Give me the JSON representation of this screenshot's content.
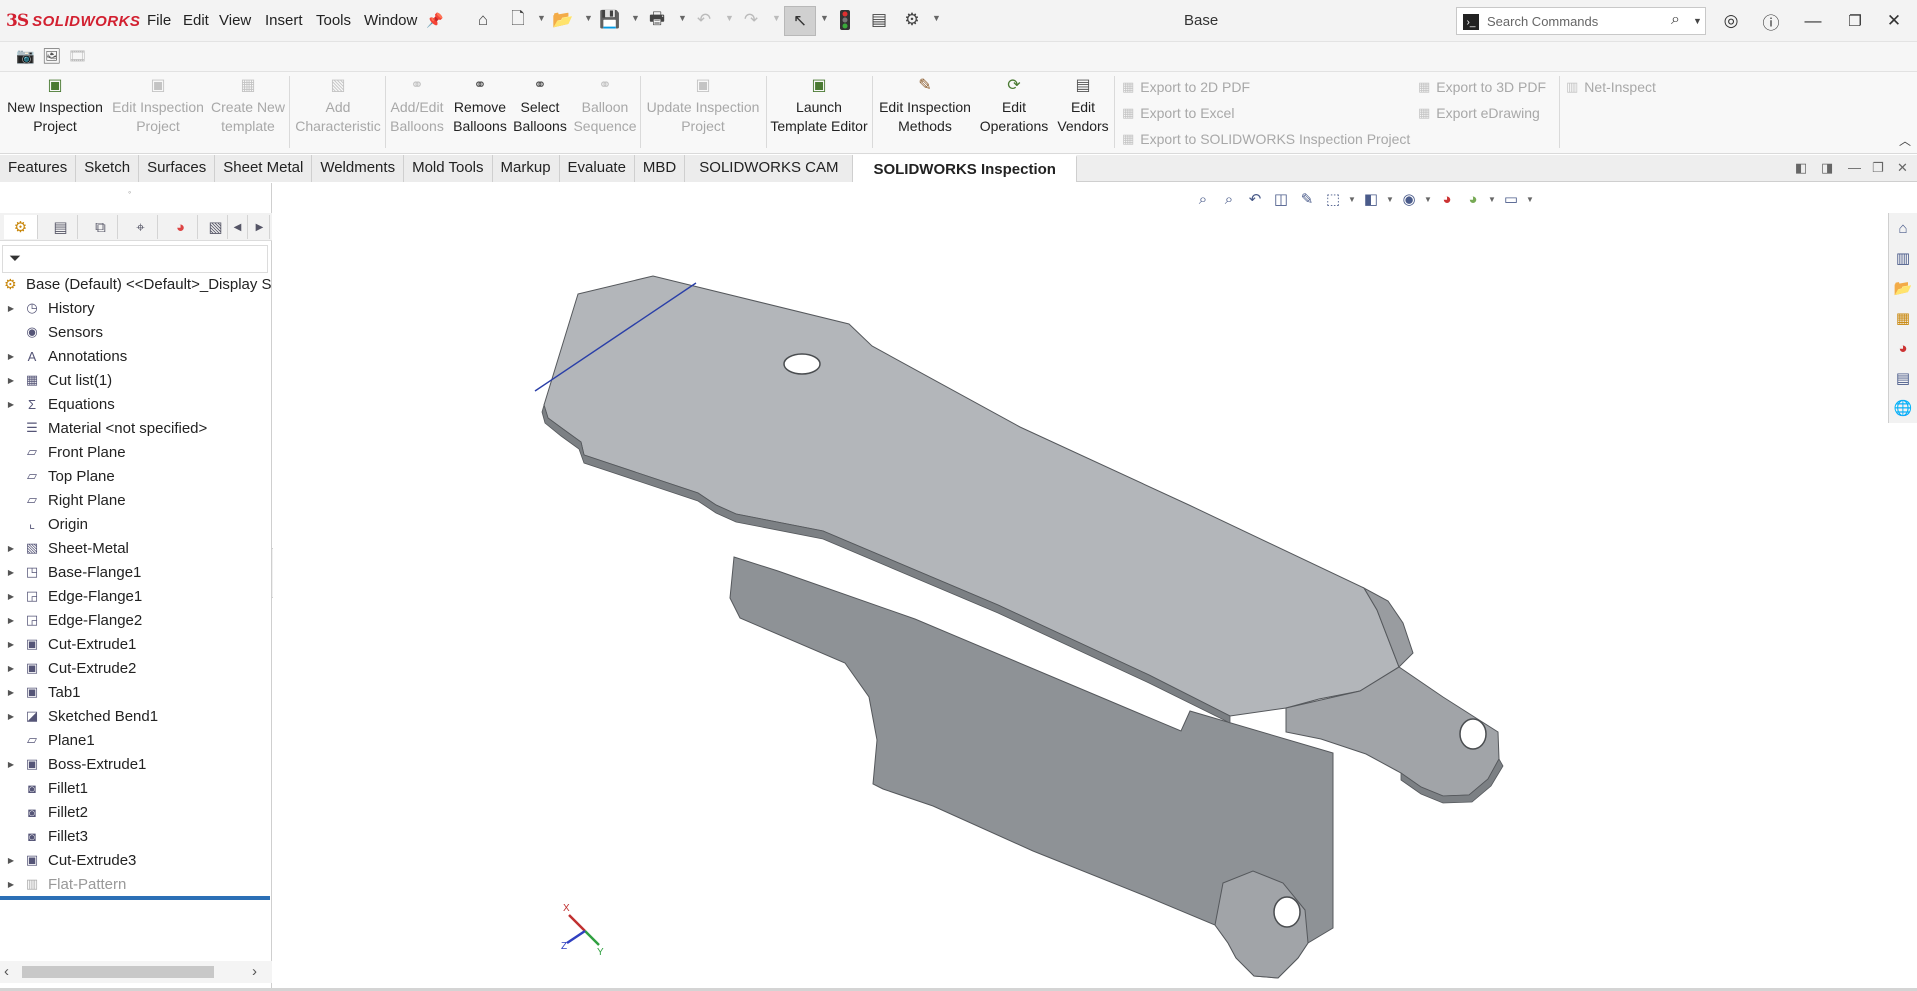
{
  "app": {
    "brand": "SOLIDWORKS",
    "brand_mark": "3S",
    "document_title": "Base"
  },
  "menu": [
    "File",
    "Edit",
    "View",
    "Insert",
    "Tools",
    "Window"
  ],
  "search": {
    "placeholder": "Search Commands"
  },
  "ribbon": {
    "buttons": [
      {
        "label": "New Inspection Project",
        "l1": "New Inspection",
        "l2": "Project",
        "enabled": true
      },
      {
        "label": "Edit Inspection Project",
        "l1": "Edit Inspection",
        "l2": "Project",
        "enabled": false
      },
      {
        "label": "Create New template",
        "l1": "Create New",
        "l2": "template",
        "enabled": false
      },
      {
        "label": "Add Characteristic",
        "l1": "Add",
        "l2": "Characteristic",
        "enabled": false
      },
      {
        "label": "Add/Edit Balloons",
        "l1": "Add/Edit",
        "l2": "Balloons",
        "enabled": false
      },
      {
        "label": "Remove Balloons",
        "l1": "Remove",
        "l2": "Balloons",
        "enabled": true
      },
      {
        "label": "Select Balloons",
        "l1": "Select",
        "l2": "Balloons",
        "enabled": true
      },
      {
        "label": "Balloon Sequence",
        "l1": "Balloon",
        "l2": "Sequence",
        "enabled": false
      },
      {
        "label": "Update Inspection Project",
        "l1": "Update Inspection",
        "l2": "Project",
        "enabled": false
      },
      {
        "label": "Launch Template Editor",
        "l1": "Launch",
        "l2": "Template Editor",
        "enabled": true
      },
      {
        "label": "Edit Inspection Methods",
        "l1": "Edit Inspection",
        "l2": "Methods",
        "enabled": true
      },
      {
        "label": "Edit Operations",
        "l1": "Edit",
        "l2": "Operations",
        "enabled": true
      },
      {
        "label": "Edit Vendors",
        "l1": "Edit",
        "l2": "Vendors",
        "enabled": true
      }
    ],
    "exports": {
      "pdf2d": "Export to 2D PDF",
      "excel": "Export to Excel",
      "sw_project": "Export to SOLIDWORKS Inspection Project",
      "pdf3d": "Export to 3D PDF",
      "edrawing": "Export eDrawing",
      "net_inspect": "Net-Inspect"
    }
  },
  "tabs": [
    {
      "label": "Features",
      "active": false
    },
    {
      "label": "Sketch",
      "active": false
    },
    {
      "label": "Surfaces",
      "active": false
    },
    {
      "label": "Sheet Metal",
      "active": false
    },
    {
      "label": "Weldments",
      "active": false
    },
    {
      "label": "Mold Tools",
      "active": false
    },
    {
      "label": "Markup",
      "active": false
    },
    {
      "label": "Evaluate",
      "active": false
    },
    {
      "label": "MBD",
      "active": false
    },
    {
      "label": "SOLIDWORKS CAM",
      "active": false
    },
    {
      "label": "SOLIDWORKS Inspection",
      "active": true
    }
  ],
  "feature_tree": {
    "root": "Base (Default) <<Default>_Display S",
    "items": [
      {
        "label": "History",
        "icon": "history-icon",
        "expandable": true
      },
      {
        "label": "Sensors",
        "icon": "sensor-icon",
        "expandable": false
      },
      {
        "label": "Annotations",
        "icon": "annotation-icon",
        "expandable": true
      },
      {
        "label": "Cut list(1)",
        "icon": "cut-list-icon",
        "expandable": true
      },
      {
        "label": "Equations",
        "icon": "equation-icon",
        "expandable": true
      },
      {
        "label": "Material <not specified>",
        "icon": "material-icon",
        "expandable": false
      },
      {
        "label": "Front Plane",
        "icon": "plane-icon",
        "expandable": false
      },
      {
        "label": "Top Plane",
        "icon": "plane-icon",
        "expandable": false
      },
      {
        "label": "Right Plane",
        "icon": "plane-icon",
        "expandable": false
      },
      {
        "label": "Origin",
        "icon": "origin-icon",
        "expandable": false
      },
      {
        "label": "Sheet-Metal",
        "icon": "sheet-metal-icon",
        "expandable": true
      },
      {
        "label": "Base-Flange1",
        "icon": "base-flange-icon",
        "expandable": true
      },
      {
        "label": "Edge-Flange1",
        "icon": "edge-flange-icon",
        "expandable": true
      },
      {
        "label": "Edge-Flange2",
        "icon": "edge-flange-icon",
        "expandable": true
      },
      {
        "label": "Cut-Extrude1",
        "icon": "cut-extrude-icon",
        "expandable": true
      },
      {
        "label": "Cut-Extrude2",
        "icon": "cut-extrude-icon",
        "expandable": true
      },
      {
        "label": "Tab1",
        "icon": "tab-icon",
        "expandable": true
      },
      {
        "label": "Sketched Bend1",
        "icon": "sketched-bend-icon",
        "expandable": true
      },
      {
        "label": "Plane1",
        "icon": "plane-icon",
        "expandable": false
      },
      {
        "label": "Boss-Extrude1",
        "icon": "boss-extrude-icon",
        "expandable": true
      },
      {
        "label": "Fillet1",
        "icon": "fillet-icon",
        "expandable": false
      },
      {
        "label": "Fillet2",
        "icon": "fillet-icon",
        "expandable": false
      },
      {
        "label": "Fillet3",
        "icon": "fillet-icon",
        "expandable": false
      },
      {
        "label": "Cut-Extrude3",
        "icon": "cut-extrude-icon",
        "expandable": true
      },
      {
        "label": "Flat-Pattern",
        "icon": "flat-pattern-icon",
        "expandable": true,
        "suppressed": true
      }
    ]
  },
  "triad": {
    "x": "X",
    "y": "Y",
    "z": "Z"
  },
  "colors": {
    "brand_red": "#d22030",
    "model_top": "#b3b6ba",
    "model_side": "#8e9296",
    "rollback_bar": "#2b6fb6",
    "edge_highlight": "#2a3fa8"
  }
}
